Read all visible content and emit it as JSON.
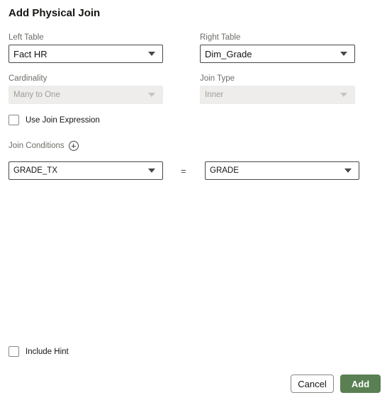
{
  "dialog": {
    "title": "Add Physical Join"
  },
  "left_table": {
    "label": "Left Table",
    "value": "Fact HR"
  },
  "right_table": {
    "label": "Right Table",
    "value": "Dim_Grade"
  },
  "cardinality": {
    "label": "Cardinality",
    "value": "Many to One",
    "disabled": true
  },
  "join_type": {
    "label": "Join Type",
    "value": "Inner",
    "disabled": true
  },
  "use_join_expression": {
    "label": "Use Join Expression",
    "checked": false
  },
  "join_conditions": {
    "label": "Join Conditions",
    "add_icon": "plus-circle-icon",
    "rows": [
      {
        "left_column": "GRADE_TX",
        "operator": "=",
        "right_column": "GRADE"
      }
    ]
  },
  "include_hint": {
    "label": "Include Hint",
    "checked": false
  },
  "footer": {
    "cancel_label": "Cancel",
    "add_label": "Add",
    "add_color": "#5a7f53"
  }
}
